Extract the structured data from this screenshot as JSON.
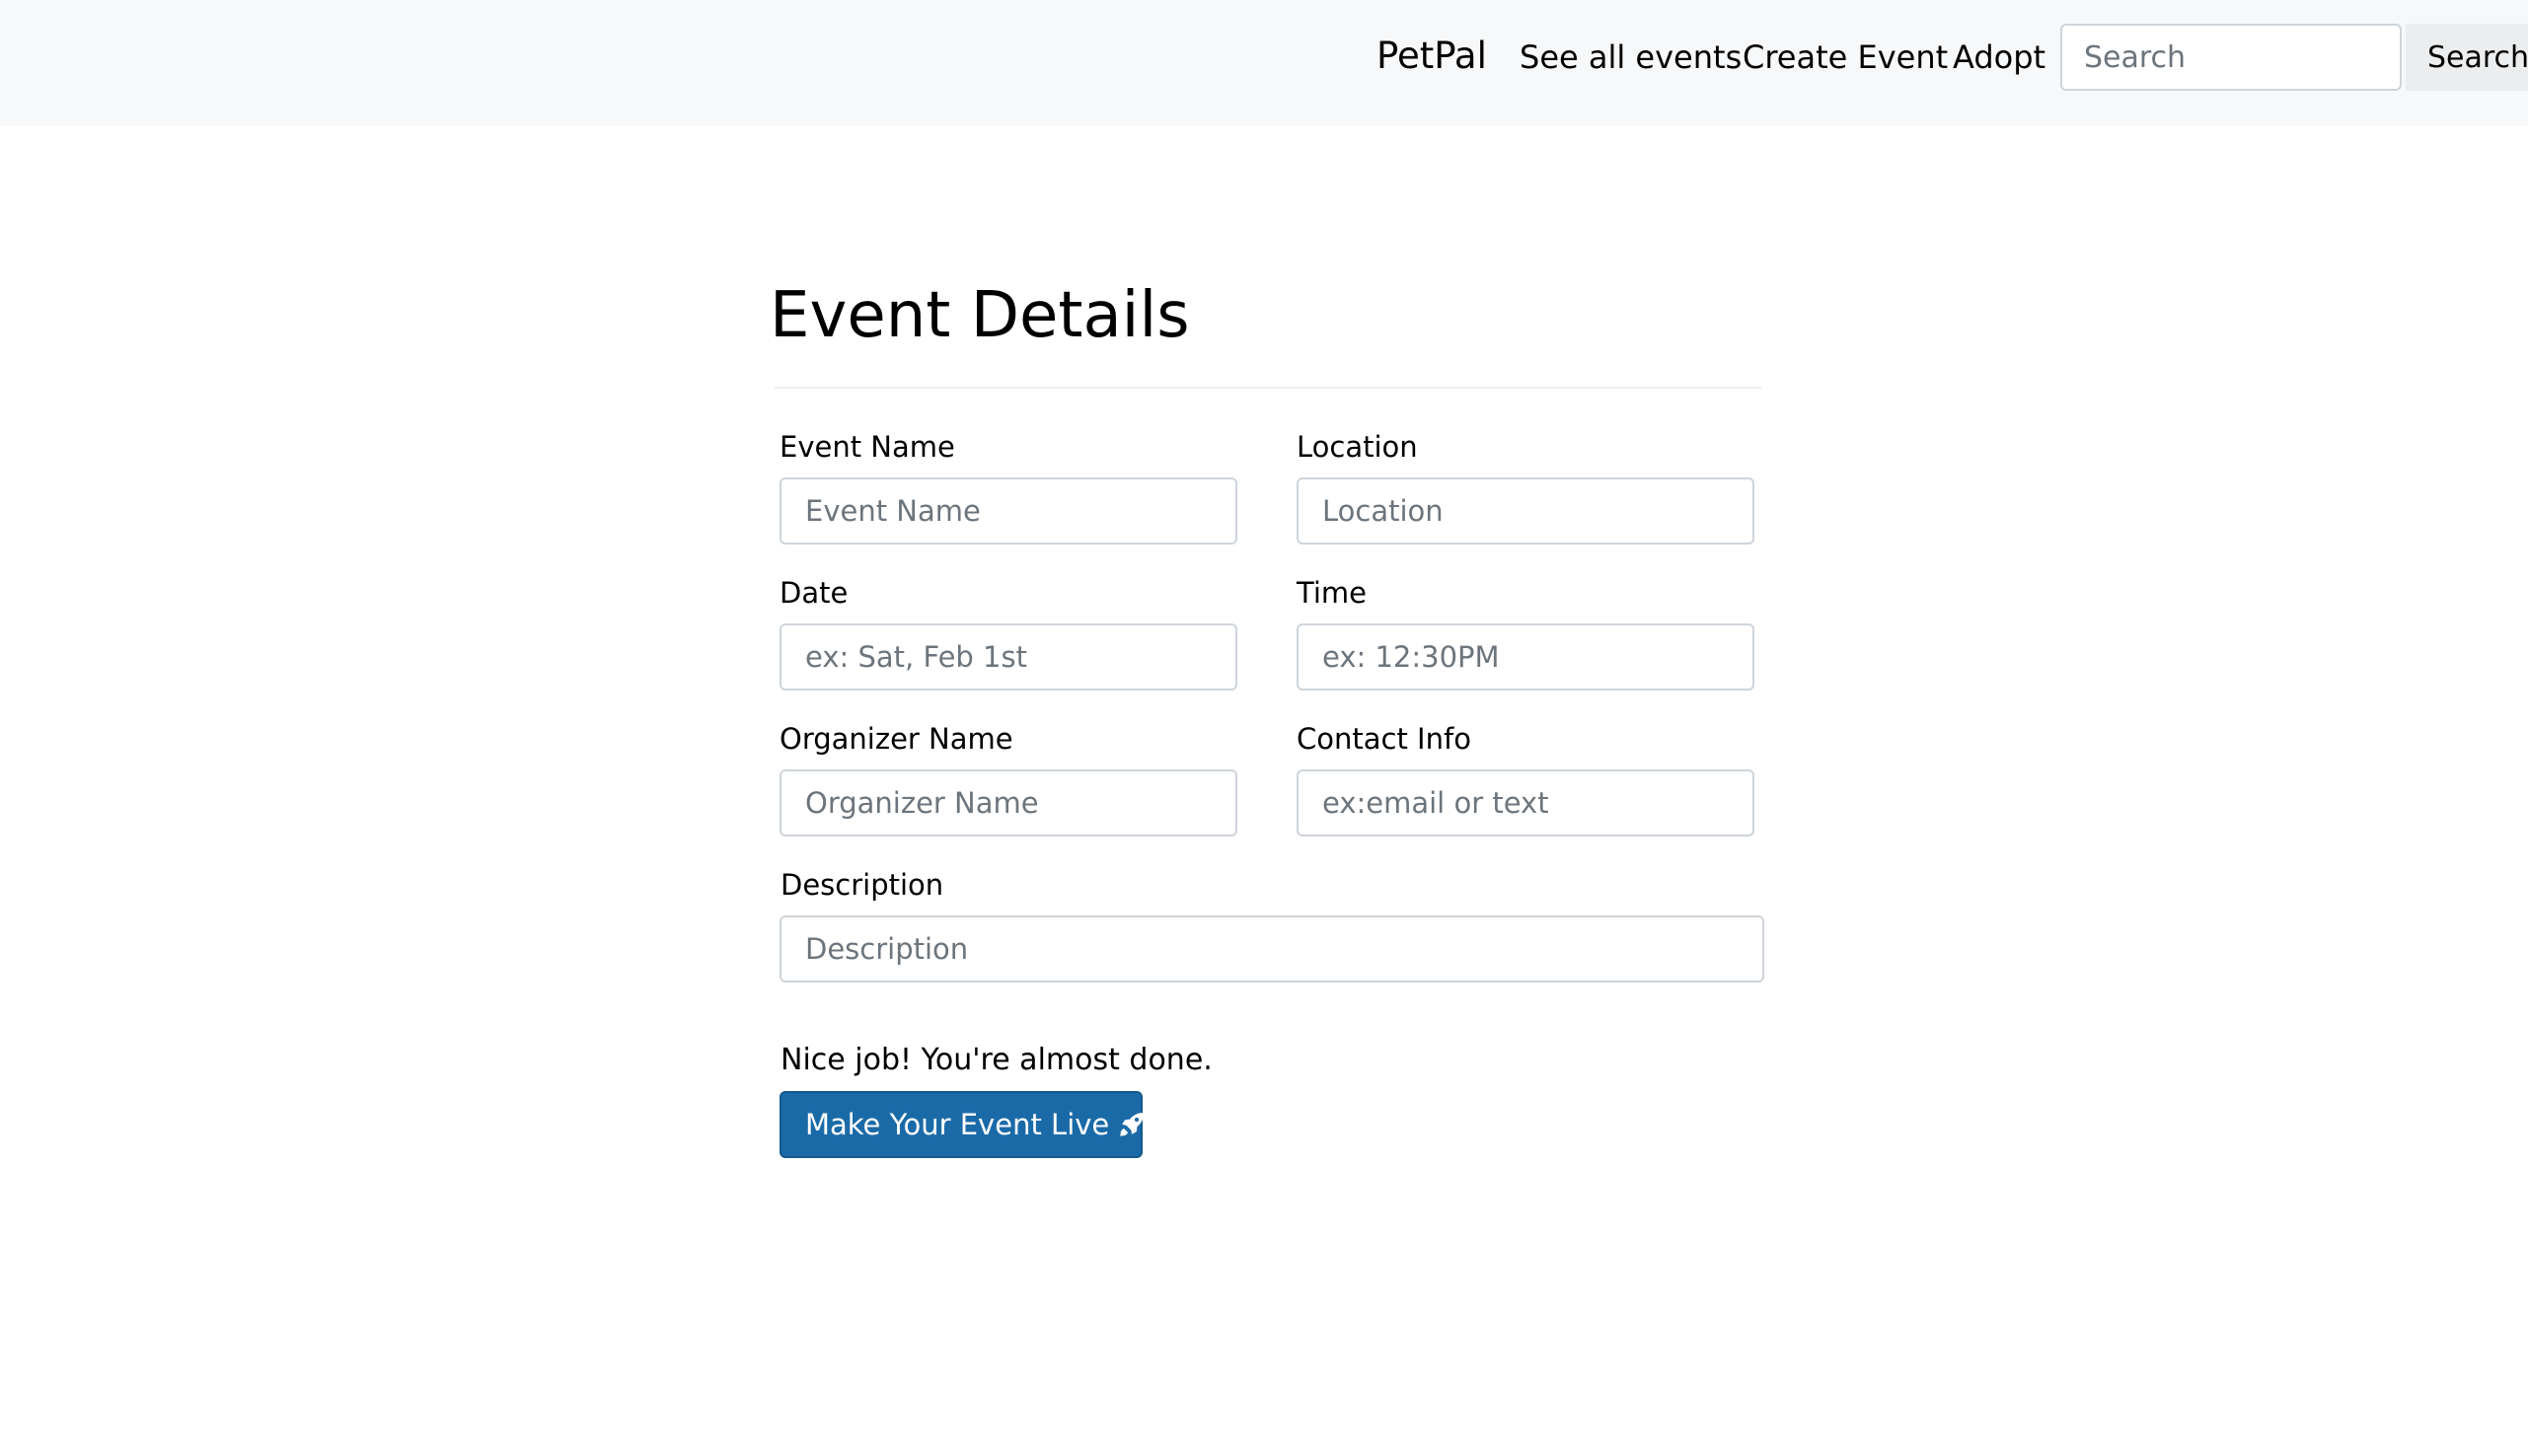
{
  "navbar": {
    "brand": "PetPal",
    "links": [
      {
        "label": "See all events"
      },
      {
        "label": "Create Event"
      },
      {
        "label": "Adopt"
      }
    ],
    "search": {
      "placeholder": "Search",
      "value": "",
      "button_label": "Search"
    }
  },
  "form": {
    "title": "Event Details",
    "fields": {
      "event_name": {
        "label": "Event Name",
        "placeholder": "Event Name",
        "value": ""
      },
      "location": {
        "label": "Location",
        "placeholder": "Location",
        "value": ""
      },
      "date": {
        "label": "Date",
        "placeholder": "ex: Sat, Feb 1st",
        "value": ""
      },
      "time": {
        "label": "Time",
        "placeholder": "ex: 12:30PM",
        "value": ""
      },
      "organizer_name": {
        "label": "Organizer Name",
        "placeholder": "Organizer Name",
        "value": ""
      },
      "contact_info": {
        "label": "Contact Info",
        "placeholder": "ex:email or text",
        "value": ""
      },
      "description": {
        "label": "Description",
        "placeholder": "Description",
        "value": ""
      }
    },
    "status_text": "Nice job! You're almost done.",
    "submit": {
      "label": "Make Your Event Live",
      "icon": "rocket-icon"
    }
  },
  "colors": {
    "navbar_bg": "#f7f8f9",
    "primary": "#1b6aa8",
    "input_border": "#ced4da",
    "placeholder": "#6c757d"
  }
}
